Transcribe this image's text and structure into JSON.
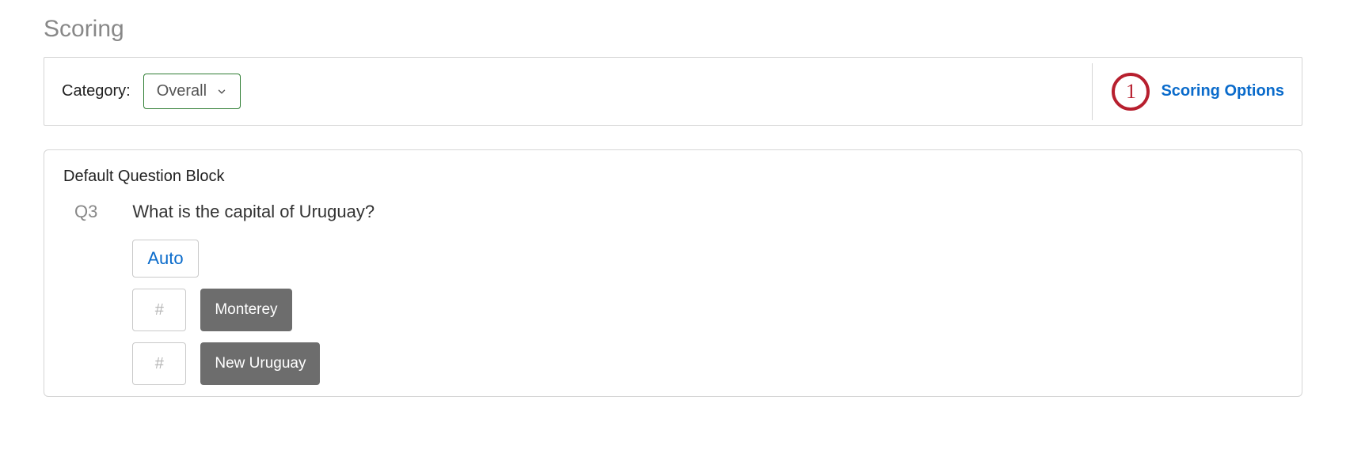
{
  "page_title": "Scoring",
  "category": {
    "label": "Category:",
    "selected": "Overall"
  },
  "callout_number": "1",
  "scoring_options_label": "Scoring Options",
  "block": {
    "title": "Default Question Block",
    "question": {
      "id": "Q3",
      "text": "What is the capital of Uruguay?",
      "auto_label": "Auto",
      "score_placeholder": "#",
      "answers": [
        {
          "label": "Monterey"
        },
        {
          "label": "New Uruguay"
        }
      ]
    }
  }
}
